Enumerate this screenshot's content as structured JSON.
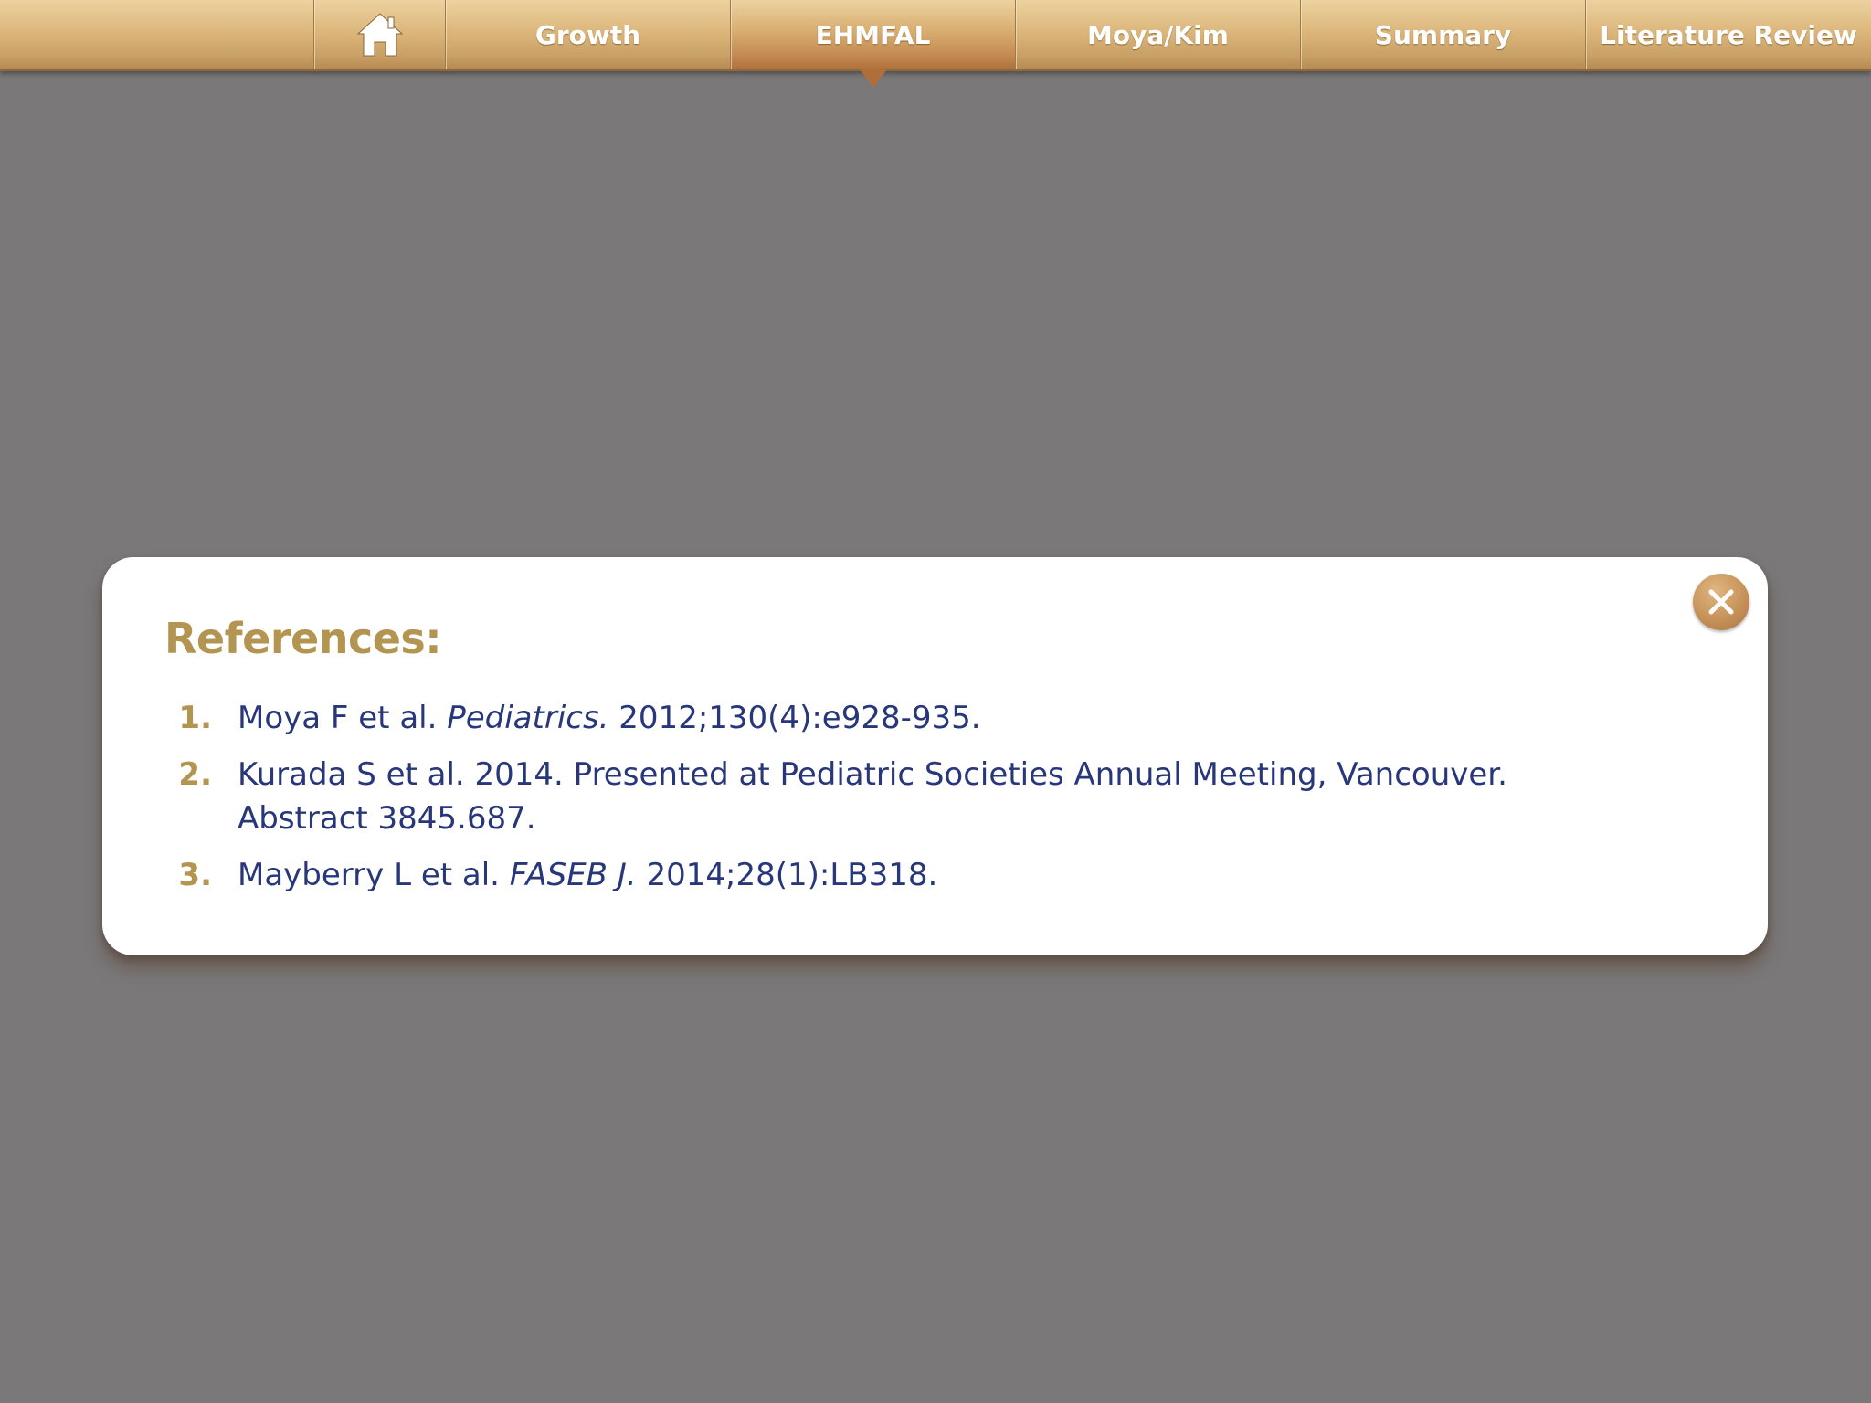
{
  "nav": {
    "tabs": [
      {
        "label": "Growth"
      },
      {
        "label": "EHMFAL"
      },
      {
        "label": "Moya/Kim"
      },
      {
        "label": "Summary"
      },
      {
        "label": "Literature Review"
      }
    ],
    "active_tab": "EHMFAL",
    "home_icon": "home-icon"
  },
  "modal": {
    "title": "References:",
    "close_icon": "close-icon",
    "references": [
      {
        "number": "1.",
        "authors": "Moya F et al. ",
        "journal": "Pediatrics.",
        "details": " 2012;130(4):e928-935."
      },
      {
        "number": "2.",
        "authors": "Kurada S et al. 2014. Presented at Pediatric Societies Annual Meeting, Vancouver. Abstract 3845.687.",
        "journal": "",
        "details": ""
      },
      {
        "number": "3.",
        "authors": "Mayberry L et al. ",
        "journal": "FASEB J.",
        "details": " 2014;28(1):LB318."
      }
    ]
  },
  "colors": {
    "background": "#7a7879",
    "nav_gold": "#dcb77c",
    "accent_gold": "#b39450",
    "reference_text": "#27377a",
    "modal_bg": "#ffffff"
  }
}
